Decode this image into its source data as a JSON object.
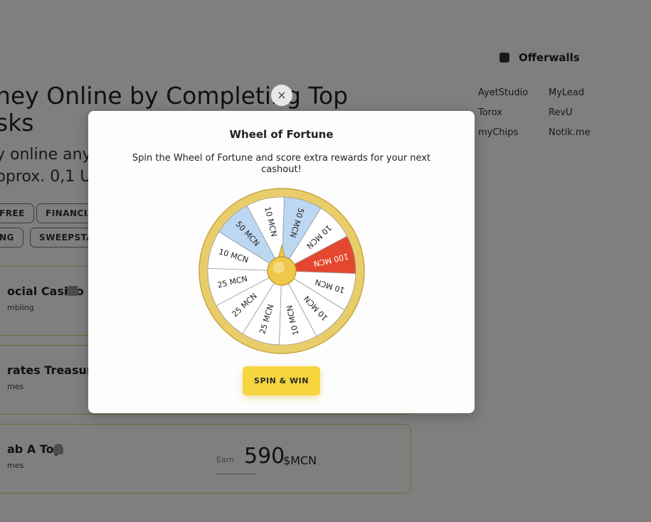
{
  "background": {
    "hero_title_line1": "ney Online by Completing Top",
    "hero_title_line2": "sks",
    "hero_sub_line1": "y online any",
    "hero_sub_line2": "pprox. 0,1 US",
    "filters": [
      "FREE",
      "FINANCIA",
      "NG",
      "SWEEPSTA"
    ],
    "offers": [
      {
        "title": "ocial Casino",
        "category": "mbling"
      },
      {
        "title": "rates Treasure",
        "category": "mes"
      },
      {
        "title": "ab A Toy",
        "category": "mes",
        "earn_label": "Earn",
        "amount": "590",
        "unit": "$MCN"
      }
    ],
    "offerwalls": {
      "title": "Offerwalls",
      "icon": "offerwall-icon",
      "links": [
        "AyetStudio",
        "MyLead",
        "Torox",
        "RevU",
        "myChips",
        "Notik.me"
      ]
    }
  },
  "modal": {
    "close": "×",
    "title": "Wheel of Fortune",
    "description": "Spin the Wheel of Fortune and score extra rewards for your next cashout!",
    "spin_button": "SPIN & WIN"
  },
  "wheel": {
    "segments": [
      "10 MCN",
      "50 MCN",
      "10 MCN",
      "50 MCN",
      "10 MCN",
      "100 MCN",
      "10 MCN",
      "10 MCN",
      "10 MCN",
      "25 MCN",
      "25 MCN",
      "25 MCN"
    ],
    "segment_colors": [
      "#ffffff",
      "#bcd7f2",
      "#ffffff",
      "#bcd7f2",
      "#ffffff",
      "#e4472f",
      "#ffffff",
      "#ffffff",
      "#ffffff",
      "#ffffff",
      "#ffffff",
      "#ffffff"
    ],
    "rim_color": "#e9cd6a",
    "hub_color": "#efc84a"
  }
}
